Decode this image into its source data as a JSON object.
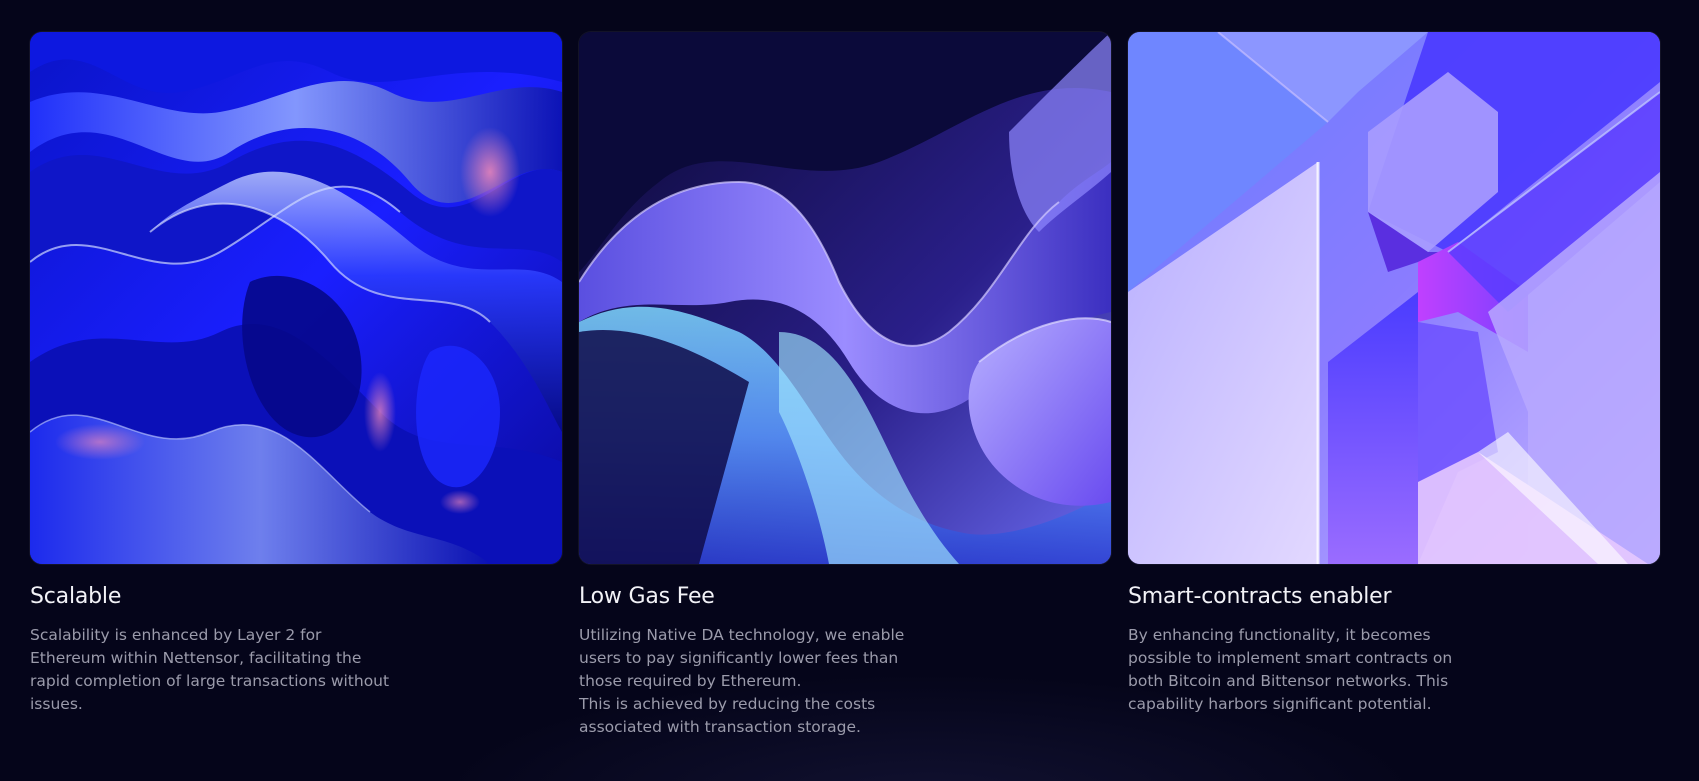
{
  "features": [
    {
      "title": "Scalable",
      "description": "Scalability is enhanced by Layer 2 for Ethereum within Nettensor, facilitating the rapid completion of large transactions without issues.",
      "image_icon": "chrome-liquid-waves-image"
    },
    {
      "title": "Low Gas Fee",
      "description": "Utilizing Native DA technology, we enable users to pay significantly lower fees than those required by Ethereum.\nThis is achieved by reducing the costs associated with transaction storage.",
      "image_icon": "silk-ribbon-waves-image"
    },
    {
      "title": "Smart-contracts enabler",
      "description": "By enhancing functionality, it becomes possible to implement smart contracts on both Bitcoin and Bittensor networks. This capability harbors significant potential.",
      "image_icon": "glass-cubes-image"
    }
  ],
  "colors": {
    "background": "#05051a",
    "title": "#f2f2f7",
    "description": "#9b9bab",
    "accent_blue": "#1f2bff",
    "accent_violet": "#8b5cf6"
  }
}
